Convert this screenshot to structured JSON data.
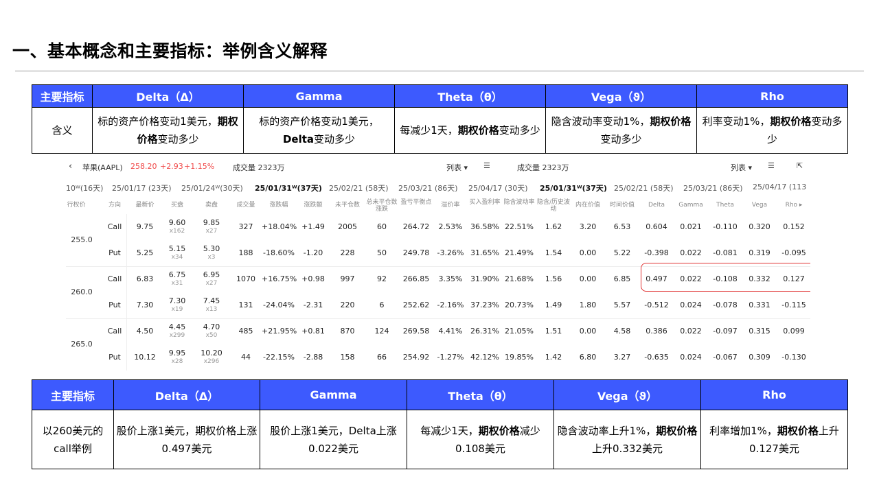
{
  "title": "一、基本概念和主要指标：举例含义解释",
  "table1": {
    "headers": [
      "主要指标",
      "Delta（Δ）",
      "Gamma",
      "Theta（θ）",
      "Vega（ϑ）",
      "Rho"
    ],
    "row_label": "含义",
    "cells": [
      {
        "pre": "标的资产价格变动1美元，",
        "bold": "期权价格",
        "post": "变动多少"
      },
      {
        "pre": "标的资产价格变动1美元，",
        "bold": "Delta",
        "post": "变动多少"
      },
      {
        "pre": "每减少1天，",
        "bold": "期权价格",
        "post": "变动多少"
      },
      {
        "pre": "隐含波动率变动1%，",
        "bold": "期权价格",
        "post": "变动多少"
      },
      {
        "pre": "利率变动1%，",
        "bold": "期权价格",
        "post": "变动多少"
      }
    ]
  },
  "table2": {
    "headers": [
      "主要指标",
      "Delta（Δ）",
      "Gamma",
      "Theta（θ）",
      "Vega（ϑ）",
      "Rho"
    ],
    "row_label": "以260美元的call举例",
    "cells": [
      {
        "pre": "股价上涨1美元，期权价格上涨0.497美元",
        "bold": "",
        "post": ""
      },
      {
        "pre": "股价上涨1美元，Delta上涨0.022美元",
        "bold": "",
        "post": ""
      },
      {
        "pre": "每减少1天，",
        "bold": "期权价格",
        "post": "减少0.108美元"
      },
      {
        "pre": "隐含波动率上升1%，",
        "bold": "期权价格",
        "post": "上升0.332美元"
      },
      {
        "pre": "利率增加1%，",
        "bold": "期权价格",
        "post": "上升0.127美元"
      }
    ]
  },
  "screenshot": {
    "back": "‹",
    "stock_name": "苹果(AAPL)",
    "price": "258.20",
    "change": "+2.93",
    "change_pct": "+1.15%",
    "volume_left": "成交量  2323万",
    "list_left": "列表 ▾",
    "volume_right": "成交量  2323万",
    "list_right": "列表 ▾",
    "expiries": [
      {
        "label": "10ᵂ(16天)",
        "on": false
      },
      {
        "label": "25/01/17 (23天)",
        "on": false
      },
      {
        "label": "25/01/24ᵂ(30天)",
        "on": false
      },
      {
        "label": "25/01/31ᵂ(37天)",
        "on": true
      },
      {
        "label": "25/02/21 (58天)",
        "on": false
      },
      {
        "label": "25/03/21 (86天)",
        "on": false
      },
      {
        "label": "25/04/17 (30天)",
        "on": false
      },
      {
        "label": "25/01/31ᵂ(37天)",
        "on": true
      },
      {
        "label": "25/02/21 (58天)",
        "on": false
      },
      {
        "label": "25/03/21 (86天)",
        "on": false
      },
      {
        "label": "25/04/17 (113",
        "on": false
      }
    ],
    "columns": [
      "行权价",
      "方向",
      "最新价",
      "买盘",
      "卖盘",
      "成交量",
      "涨跌幅",
      "涨跌额",
      "未平仓数",
      "总未平仓数涨跌",
      "盈亏平衡点",
      "溢价率",
      "买入盈利率",
      "隐含波动率",
      "隐含/历史波动",
      "内在价值",
      "时间价值",
      "Delta",
      "Gamma",
      "Theta",
      "Vega",
      "Rho ▸"
    ],
    "strikes": [
      "255.0",
      "260.0",
      "265.0"
    ],
    "rows": [
      [
        "Call",
        "9.75",
        "9.60",
        "x162",
        "9.85",
        "x27",
        "327",
        "+18.04%",
        "+1.49",
        "2005",
        "60",
        "264.72",
        "2.53%",
        "36.58%",
        "22.51%",
        "1.62",
        "3.20",
        "6.53",
        "0.604",
        "0.021",
        "-0.110",
        "0.320",
        "0.152"
      ],
      [
        "Put",
        "5.25",
        "5.15",
        "x34",
        "5.30",
        "x3",
        "188",
        "-18.60%",
        "-1.20",
        "228",
        "50",
        "249.78",
        "-3.26%",
        "31.65%",
        "21.49%",
        "1.54",
        "0.00",
        "5.22",
        "-0.398",
        "0.022",
        "-0.081",
        "0.319",
        "-0.095"
      ],
      [
        "Call",
        "6.83",
        "6.75",
        "x31",
        "6.95",
        "x27",
        "1070",
        "+16.75%",
        "+0.98",
        "997",
        "92",
        "266.85",
        "3.35%",
        "31.90%",
        "21.68%",
        "1.56",
        "0.00",
        "6.85",
        "0.497",
        "0.022",
        "-0.108",
        "0.332",
        "0.127"
      ],
      [
        "Put",
        "7.30",
        "7.30",
        "x19",
        "7.45",
        "x13",
        "131",
        "-24.04%",
        "-2.31",
        "220",
        "6",
        "252.62",
        "-2.16%",
        "37.23%",
        "20.73%",
        "1.49",
        "1.80",
        "5.57",
        "-0.512",
        "0.024",
        "-0.078",
        "0.331",
        "-0.115"
      ],
      [
        "Call",
        "4.50",
        "4.45",
        "x299",
        "4.70",
        "x50",
        "485",
        "+21.95%",
        "+0.81",
        "870",
        "124",
        "269.58",
        "4.41%",
        "26.31%",
        "21.05%",
        "1.51",
        "0.00",
        "4.58",
        "0.386",
        "0.022",
        "-0.097",
        "0.315",
        "0.099"
      ],
      [
        "Put",
        "10.12",
        "9.95",
        "x28",
        "10.20",
        "x296",
        "44",
        "-22.15%",
        "-2.88",
        "158",
        "66",
        "254.92",
        "-1.27%",
        "42.12%",
        "19.85%",
        "1.42",
        "6.80",
        "3.27",
        "-0.635",
        "0.024",
        "-0.067",
        "0.309",
        "-0.130"
      ]
    ]
  }
}
